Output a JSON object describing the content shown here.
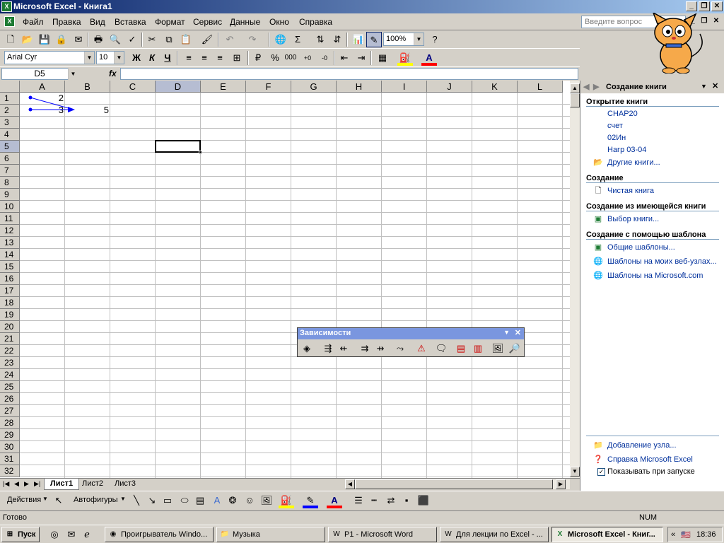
{
  "window": {
    "title": "Microsoft Excel - Книга1",
    "app_icon": "excel-icon"
  },
  "menu": {
    "items": [
      "Файл",
      "Правка",
      "Вид",
      "Вставка",
      "Формат",
      "Сервис",
      "Данные",
      "Окно",
      "Справка"
    ],
    "help_placeholder": "Введите вопрос"
  },
  "standard_toolbar": {
    "zoom": "100%"
  },
  "formatting_toolbar": {
    "font": "Arial Cyr",
    "size": "10",
    "bold": "Ж",
    "italic": "К",
    "underline": "Ч",
    "thousands": "000",
    "percent": "%"
  },
  "formula_bar": {
    "name_box": "D5",
    "fx": "fx",
    "value": ""
  },
  "sheet": {
    "columns": [
      "A",
      "B",
      "C",
      "D",
      "E",
      "F",
      "G",
      "H",
      "I",
      "J",
      "K",
      "L"
    ],
    "rows": [
      "1",
      "2",
      "3",
      "4",
      "5",
      "6",
      "7",
      "8",
      "9",
      "10",
      "11",
      "12",
      "13",
      "14",
      "15",
      "16",
      "17",
      "18",
      "19",
      "20",
      "21",
      "22",
      "23",
      "24",
      "25",
      "26",
      "27",
      "28",
      "29",
      "30",
      "31",
      "32"
    ],
    "cells": {
      "A1": "2",
      "A2": "3",
      "B2": "5"
    },
    "active_cell": "D5",
    "trace_arrow_color": "#0000ff"
  },
  "sheet_tabs": [
    "Лист1",
    "Лист2",
    "Лист3"
  ],
  "dependency_toolbar": {
    "title": "Зависимости"
  },
  "task_pane": {
    "title": "Создание книги",
    "open_section": "Открытие книги",
    "recent_files": [
      "CHAP20",
      "счет",
      "02Ин",
      "Нагр 03-04"
    ],
    "more_books": "Другие книги...",
    "create_section": "Создание",
    "blank_book": "Чистая книга",
    "from_existing_section": "Создание из имеющейся книги",
    "choose_book": "Выбор книги...",
    "template_section": "Создание с помощью шаблона",
    "general_templates": "Общие шаблоны...",
    "web_templates": "Шаблоны на моих веб-узлах...",
    "ms_templates": "Шаблоны на Microsoft.com",
    "add_node": "Добавление узла...",
    "excel_help": "Справка Microsoft Excel",
    "show_on_startup": "Показывать при запуске"
  },
  "drawing_toolbar": {
    "actions": "Действия",
    "autoshapes": "Автофигуры"
  },
  "status": {
    "text": "Готово",
    "num": "NUM"
  },
  "taskbar": {
    "start": "Пуск",
    "buttons": [
      "Проигрыватель Windo...",
      "Музыка",
      "P1 - Microsoft Word",
      "Для лекции по Excel - ...",
      "Microsoft Excel - Книг..."
    ],
    "time": "18:36",
    "tray_arrows": "«"
  }
}
